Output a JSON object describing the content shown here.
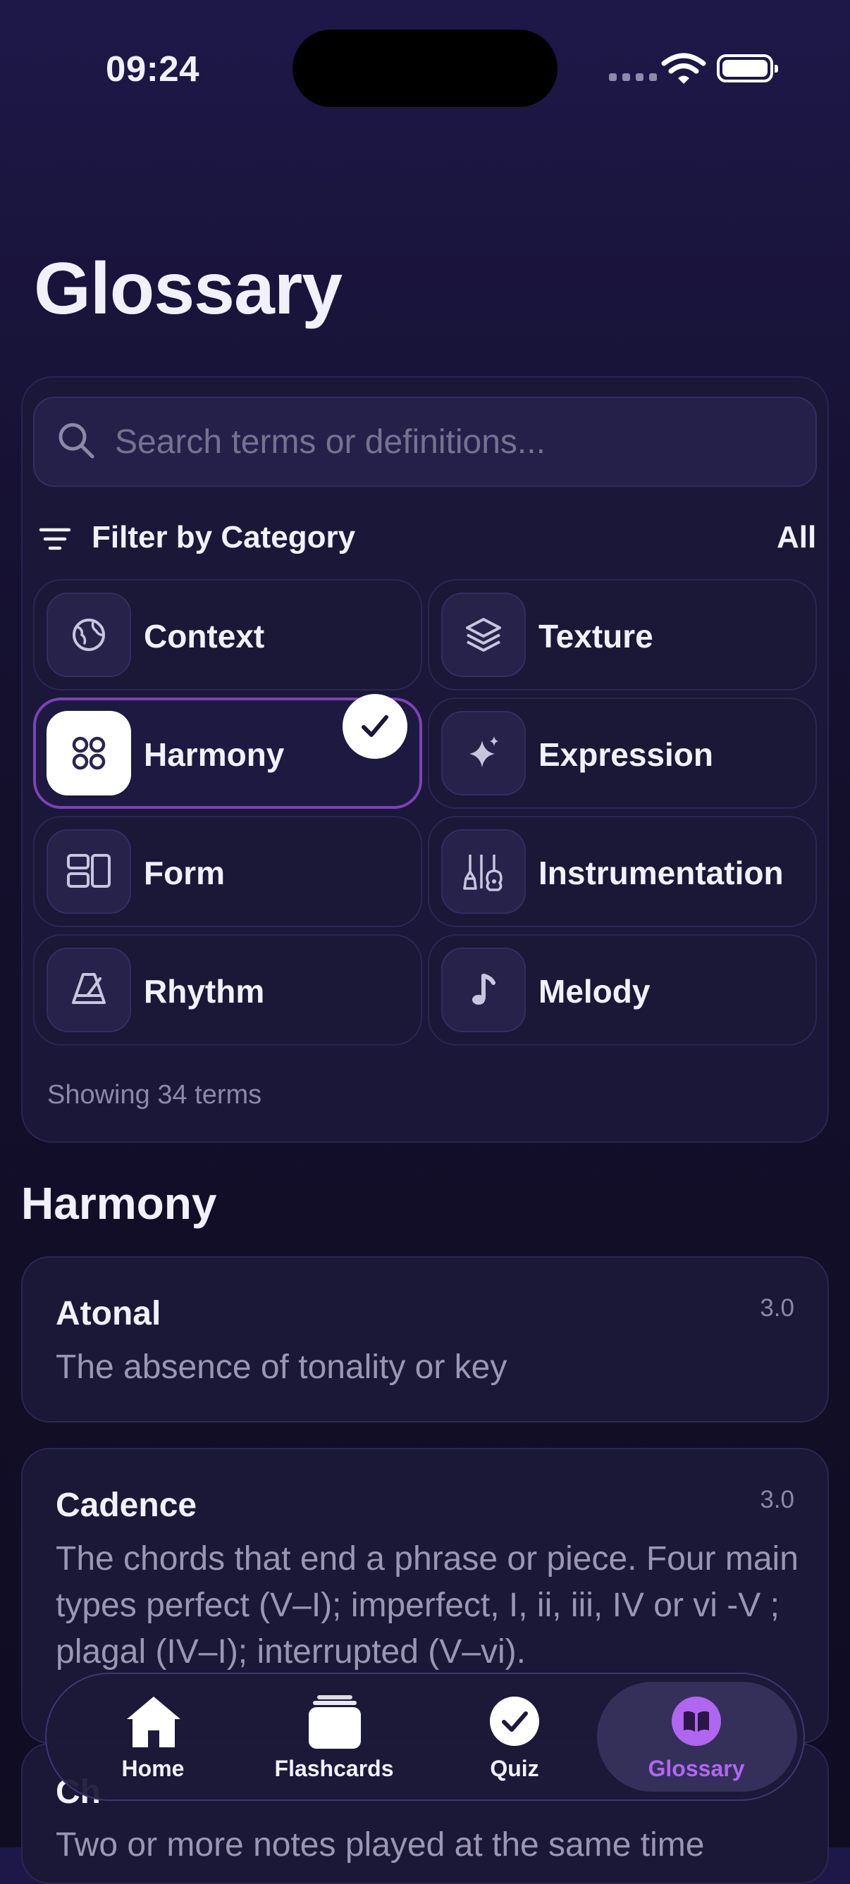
{
  "status_bar": {
    "time": "09:24"
  },
  "header": {
    "title": "Glossary"
  },
  "search": {
    "placeholder": "Search terms or definitions..."
  },
  "filter": {
    "label": "Filter by Category",
    "all_label": "All",
    "categories": [
      {
        "label": "Context",
        "icon": "globe-icon",
        "selected": false
      },
      {
        "label": "Texture",
        "icon": "layers-icon",
        "selected": false
      },
      {
        "label": "Harmony",
        "icon": "grid-circles-icon",
        "selected": true
      },
      {
        "label": "Expression",
        "icon": "sparkle-icon",
        "selected": false
      },
      {
        "label": "Form",
        "icon": "layout-icon",
        "selected": false
      },
      {
        "label": "Instrumentation",
        "icon": "instruments-icon",
        "selected": false
      },
      {
        "label": "Rhythm",
        "icon": "metronome-icon",
        "selected": false
      },
      {
        "label": "Melody",
        "icon": "music-note-icon",
        "selected": false
      }
    ],
    "count_text": "Showing 34 terms"
  },
  "section": {
    "title": "Harmony"
  },
  "terms": [
    {
      "term": "Atonal",
      "level": "3.0",
      "definition": "The absence of tonality or key"
    },
    {
      "term": "Cadence",
      "level": "3.0",
      "definition": "The chords that end a phrase or piece. Four main types perfect (V–I); imperfect, I, ii, iii, IV or vi -V ; plagal (IV–I); interrupted (V–vi)."
    },
    {
      "term": "Ch",
      "level": "",
      "definition": "Two or more notes played at the same time"
    }
  ],
  "tab_bar": {
    "tabs": [
      {
        "label": "Home",
        "icon": "home-icon",
        "active": false
      },
      {
        "label": "Flashcards",
        "icon": "cards-icon",
        "active": false
      },
      {
        "label": "Quiz",
        "icon": "check-circle-icon",
        "active": false
      },
      {
        "label": "Glossary",
        "icon": "book-icon",
        "active": true
      }
    ]
  },
  "colors": {
    "accent": "#b066f0",
    "selected_border": "#7a43b7",
    "background": "#14102d"
  }
}
